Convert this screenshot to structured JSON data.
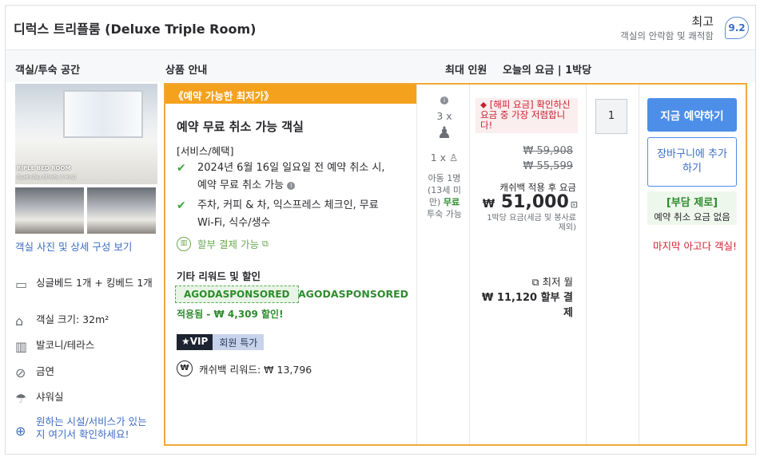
{
  "header": {
    "room_title": "디럭스 트리플룸 (Deluxe Triple Room)",
    "rating_word": "최고",
    "rating_sub": "객실의 안락함 및 쾌적함",
    "score": "9.2"
  },
  "columns": {
    "room": "객실/투숙 공간",
    "product": "상품 안내",
    "occupancy": "최대 인원",
    "price": "오늘의 요금 | 1박당"
  },
  "room_panel": {
    "photo_label_1": "RIPLE BED ROOM",
    "photo_label_2": "ห้องพักเตียง (สำหรับ 3 ท่าน)",
    "photo_link": "객실 사진 및 상세 구성 보기",
    "features": [
      {
        "icon": "bed-icon",
        "text": "싱글베드 1개 + 킹베드 1개"
      },
      {
        "icon": "room-size-icon",
        "text": "객실 크기: 32m²"
      },
      {
        "icon": "balcony-icon",
        "text": "발코니/테라스"
      },
      {
        "icon": "no-smoking-icon",
        "text": "금연"
      },
      {
        "icon": "shower-icon",
        "text": "샤워실"
      }
    ],
    "more_link": "원하는 시설/서비스가 있는지 여기서 확인하세요!"
  },
  "offer": {
    "promo_tag": "《예약 가능한 최저가》",
    "title": "예약 무료 취소 가능 객실",
    "benefit_head": "[서비스/혜택]",
    "benefits": [
      "2024년 6월 16일 일요일 전 예약 취소 시, 예약 무료 취소 가능",
      "주차, 커피 & 차, 익스프레스 체크인, 무료 Wi-Fi, 식수/생수"
    ],
    "pay_later": "할부 결제 가능",
    "other_head": "기타 리워드 및 할인",
    "coupon_code": "AGODASPONSORED",
    "coupon_code_2": "AGODASPONSORED",
    "applied": "적용됨 - ₩ 4,309 할인!",
    "vip_label": "VIP",
    "vip_member": "회원 특가",
    "cashback": "캐쉬백 리워드: ₩ 13,796"
  },
  "occupancy": {
    "adults": "3 x",
    "child": "1 x",
    "child_note": "아동 1명(13세 미만)",
    "child_free": "무료",
    "child_suffix": "투숙 가능"
  },
  "pricing": {
    "happy_deal": "[해피 요금] 확인하신 요금 중 가장 저렴합니다!",
    "original_1": "₩ 59,908",
    "original_2": "₩ 55,599",
    "cashback_applied": "캐쉬백 적용 후 요금",
    "currency": "₩",
    "price": "51,000",
    "per_night": "1박당 요금(세금 및 봉사료 제외)",
    "min_monthly": "최저 월",
    "installment": "₩ 11,120 할부 결제"
  },
  "booking": {
    "quantity": "1",
    "book_now": "지금 예약하기",
    "add_cart": "장바구니에 추가하기",
    "no_fee_title": "[부담 제로]",
    "no_fee_sub": "예약 취소 요금 없음",
    "last_room": "마지막 아고다 객실!"
  }
}
